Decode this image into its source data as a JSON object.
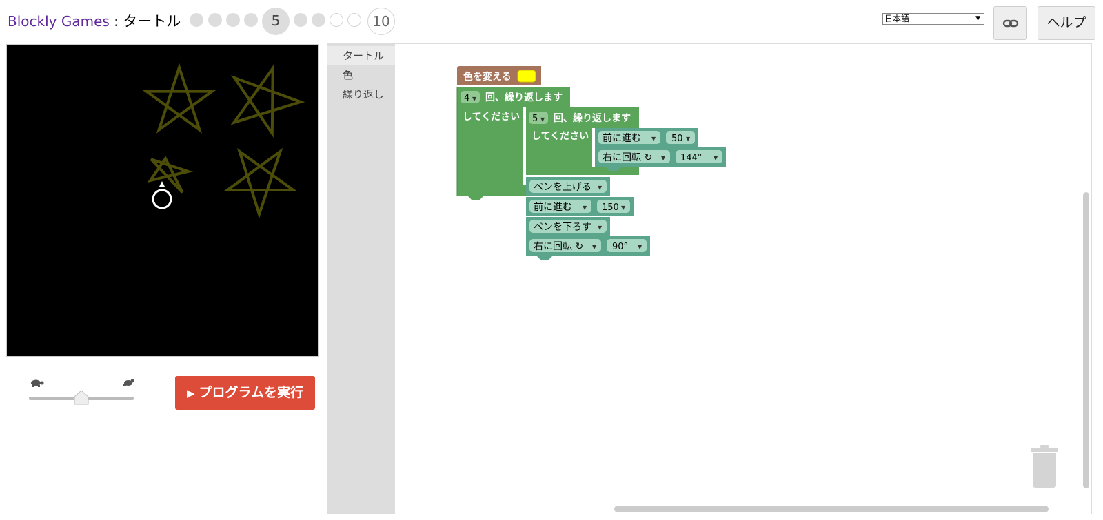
{
  "header": {
    "brand": "Blockly Games",
    "separator": " : ",
    "game": "タートル",
    "levels": [
      {
        "label": "",
        "state": "done"
      },
      {
        "label": "",
        "state": "done"
      },
      {
        "label": "",
        "state": "done"
      },
      {
        "label": "",
        "state": "done"
      },
      {
        "label": "5",
        "state": "current"
      },
      {
        "label": "",
        "state": "done"
      },
      {
        "label": "",
        "state": "done"
      },
      {
        "label": "",
        "state": "todo"
      },
      {
        "label": "",
        "state": "todo"
      },
      {
        "label": "10",
        "state": "todo"
      }
    ],
    "language": "日本語",
    "help_label": "ヘルプ",
    "link_icon": "link-icon"
  },
  "controls": {
    "run_label": "プログラムを実行",
    "slow_icon": "turtle-icon",
    "fast_icon": "rabbit-icon",
    "speed": 0.5
  },
  "canvas": {
    "background": "#000000",
    "star_color": "#4d4d0a",
    "turtle_color": "#ffffff",
    "star_count": 4
  },
  "toolbox": {
    "categories": [
      {
        "label": "タートル",
        "color": "#ebebeb"
      },
      {
        "label": "色",
        "color": "#dddddd"
      },
      {
        "label": "繰り返し",
        "color": "#dddddd"
      }
    ]
  },
  "program": {
    "set_color": {
      "label": "色を変える",
      "color": "#ffff00"
    },
    "outer_repeat": {
      "count": "4",
      "label": "回、繰り返します",
      "do": "してください"
    },
    "inner_repeat": {
      "count": "5",
      "label": "回、繰り返します",
      "do": "してください"
    },
    "inner_move": {
      "label": "前に進む",
      "value": "50"
    },
    "inner_turn": {
      "label": "右に回転 ↻",
      "value": "144°"
    },
    "pen_up": {
      "label": "ペンを上げる"
    },
    "move": {
      "label": "前に進む",
      "value": "150"
    },
    "pen_down": {
      "label": "ペンを下ろす"
    },
    "turn": {
      "label": "右に回転 ↻",
      "value": "90°"
    }
  },
  "colors": {
    "brand": "#60289a",
    "run_button": "#dd4b39",
    "loop_block": "#5ba55b",
    "turtle_block": "#5ba58c",
    "colour_block": "#a5745b"
  }
}
